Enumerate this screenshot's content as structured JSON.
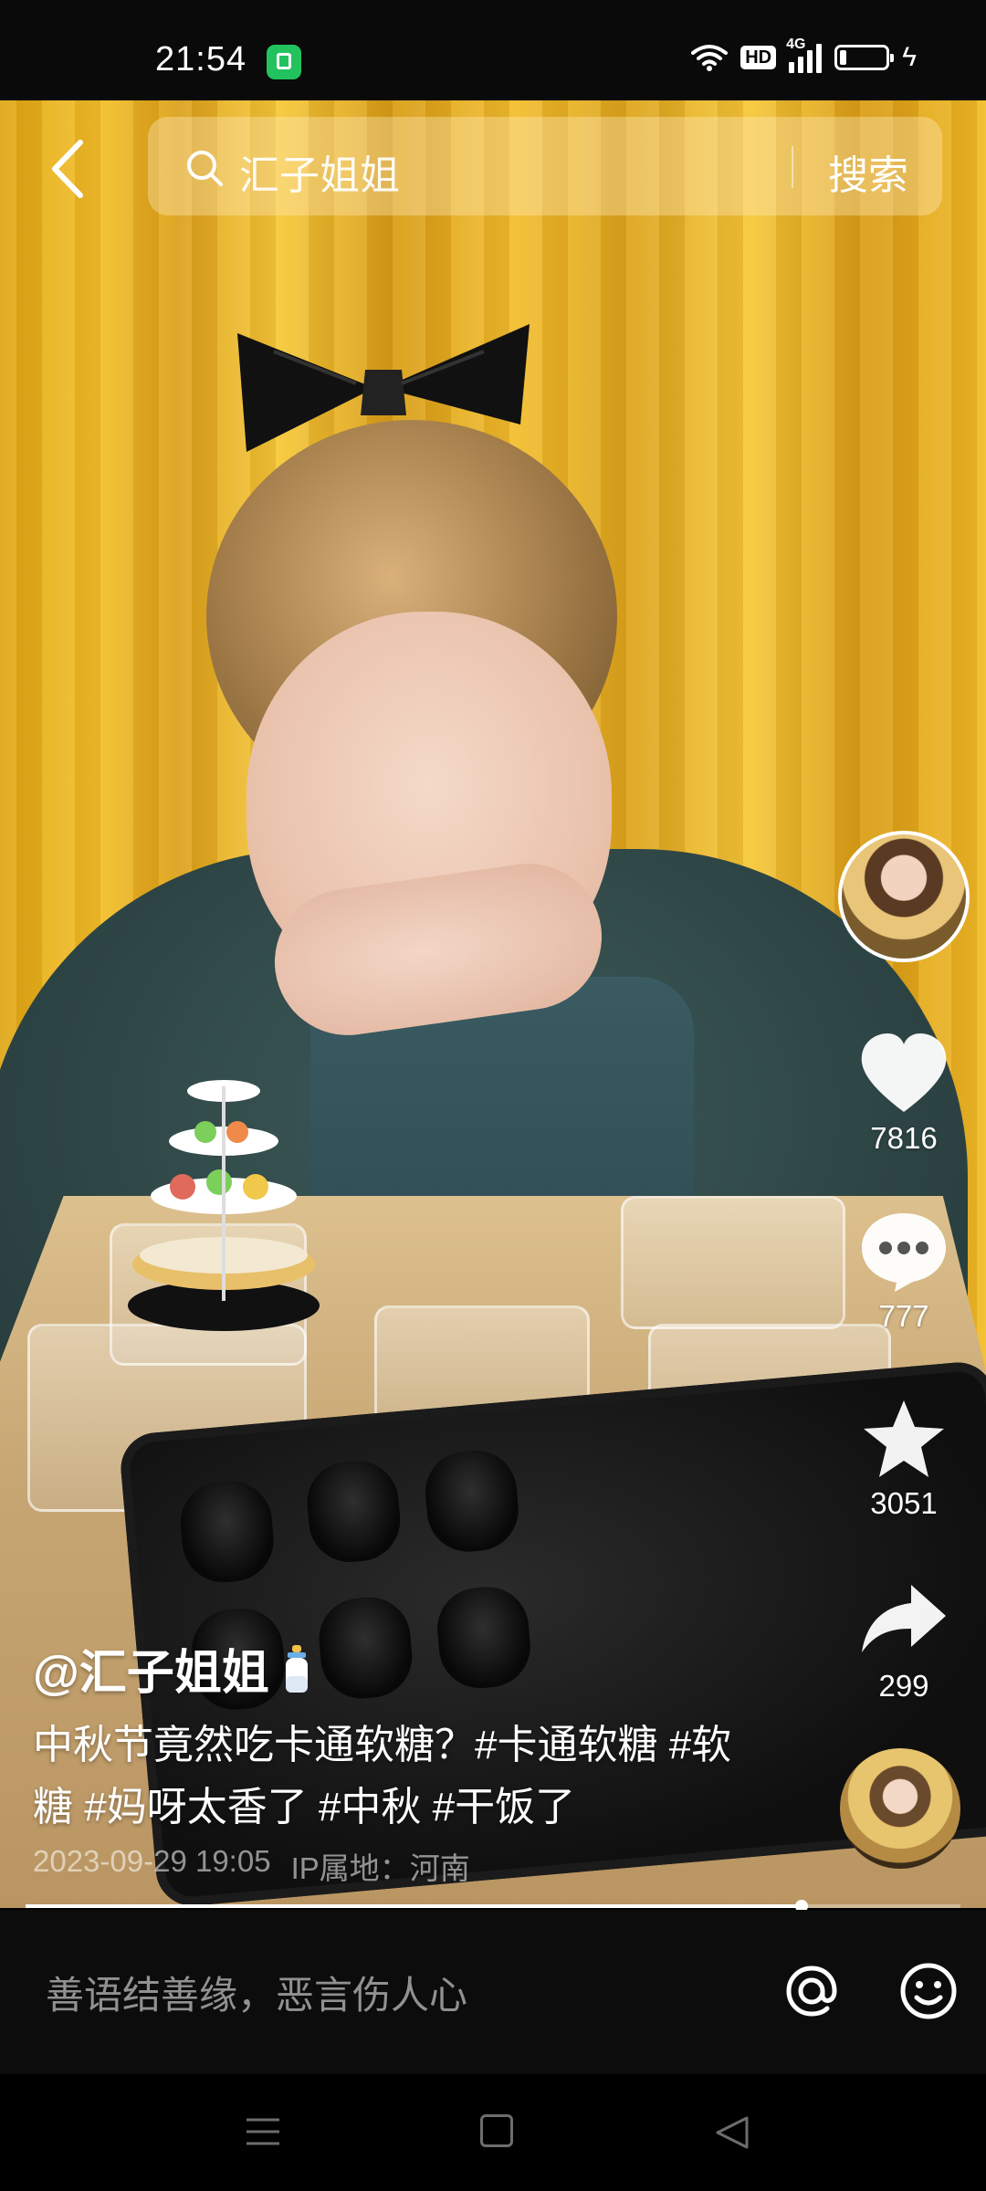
{
  "status_bar": {
    "time": "21:54",
    "hd_label": "HD",
    "network_label": "4G"
  },
  "search": {
    "query": "汇子姐姐",
    "button_label": "搜索"
  },
  "video": {
    "progress": 0.83
  },
  "actions": {
    "likes": "7816",
    "comments": "777",
    "favorites": "3051",
    "shares": "299"
  },
  "post": {
    "author": "@汇子姐姐",
    "caption": "中秋节竟然吃卡通软糖？#卡通软糖 #软糖 #妈呀太香了 #中秋 #干饭了",
    "date": "2023-09-29 19:05",
    "ip_location": "IP属地：河南"
  },
  "comment_bar": {
    "placeholder": "善语结善缘，恶言伤人心"
  },
  "icons": {
    "back": "chevron-left-icon",
    "search": "search-icon",
    "like": "heart-icon",
    "comment": "comment-bubble-icon",
    "favorite": "star-icon",
    "share": "share-arrow-icon",
    "mention": "at-icon",
    "emoji": "smiley-icon"
  }
}
